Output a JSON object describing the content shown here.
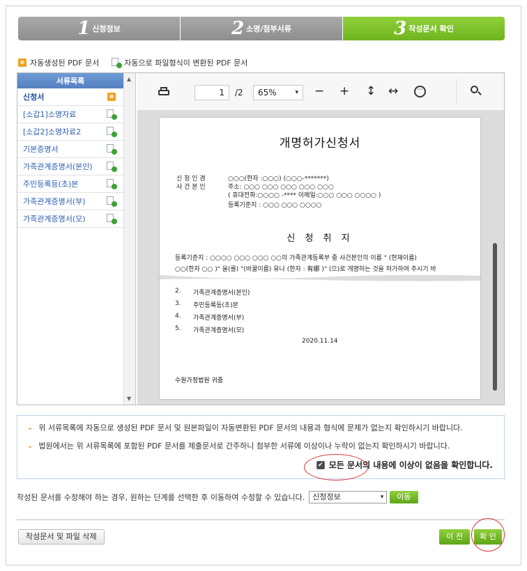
{
  "steps": [
    {
      "num": "1",
      "label": "신청정보"
    },
    {
      "num": "2",
      "label": "소명/첨부서류"
    },
    {
      "num": "3",
      "label": "작성문서 확인"
    }
  ],
  "legend": {
    "auto_pdf": "자동생성된 PDF 문서",
    "converted_pdf": "자동으로 파일형식이 변환된 PDF 문서"
  },
  "doc_list": {
    "header": "서류목록",
    "items": [
      {
        "label": "신청서",
        "icon": "e-icon"
      },
      {
        "label": "[소갑1]소명자료",
        "icon": "converted-doc-icon"
      },
      {
        "label": "[소갑2]소명자료2",
        "icon": "converted-doc-icon"
      },
      {
        "label": "기본증명서",
        "icon": "converted-doc-icon"
      },
      {
        "label": "가족관계증명서(본인)",
        "icon": "converted-doc-icon"
      },
      {
        "label": "주민등록등(초)본",
        "icon": "converted-doc-icon"
      },
      {
        "label": "가족관계증명서(부)",
        "icon": "converted-doc-icon"
      },
      {
        "label": "가족관계증명서(모)",
        "icon": "converted-doc-icon"
      }
    ]
  },
  "pdf_toolbar": {
    "page_current": "1",
    "page_total": "/2",
    "zoom": "65%",
    "zoom_out": "−",
    "zoom_in": "+",
    "fit_height": "↕",
    "fit_width": "↔",
    "more": "···"
  },
  "pdf_page": {
    "title": "개명허가신청서",
    "applicant_label1": "신 청 인 겸",
    "applicant_label2": "사 건 본 인",
    "applicant_name": "○○○(한자 :○○○) (○○○-*******)",
    "address": "주소: ○○○ ○○○ ○○○ ○○○ ○○○",
    "contact": "( 휴대전화:○○○○ -****   이메일:○○○ ○○○ ○○○○ )",
    "registry": "등록기준지 : ○○○ ○○○ ○○○○",
    "section_title": "신 청 취 지",
    "purpose_line1": "등록기준지 : ○○○○ ○○○ ○○○ ○○의 가족관계등록부 중 사건본인의 이름 \" (현재이름)",
    "purpose_line2": "○○(한자 ○○ )\" 을(를) \"(바꿀이름) 유나 (한자 : 有娜 )\" (으)로 개명하는 것을 허가하여 주시기 바",
    "attachments": [
      {
        "no": "2.",
        "label": "가족관계증명서(본인)"
      },
      {
        "no": "3.",
        "label": "주민등록등(초)본"
      },
      {
        "no": "4.",
        "label": "가족관계증명서(부)"
      },
      {
        "no": "5.",
        "label": "가족관계증명서(모)"
      }
    ],
    "date": "2020.11.14",
    "court": "수원가정법원 귀중"
  },
  "confirm": {
    "line1": "위 서류목록에 자동으로 생성된 PDF 문서 및 원본파일이 자동변환된 PDF 문서의 내용과 형식에 문제가 없는지 확인하시기 바랍니다.",
    "line2": "법원에서는 위 서류목록에 포함된 PDF 문서를 제출문서로 간주하니 첨부한 서류에 이상이나 누락이 없는지 확인하시기 바랍니다.",
    "agree_label": "모든 문서의 내용에 이상이 없음을 확인합니다."
  },
  "modify": {
    "text": "작성된 문서를 수정해야 하는 경우, 원하는 단계를 선택한 후 이동하여 수정할 수 있습니다.",
    "selected_step": "신청정보",
    "move_button": "이동"
  },
  "footer": {
    "delete_button": "작성문서 및 파일 삭제",
    "prev_button": "이 전",
    "ok_button": "확 인"
  },
  "colors": {
    "accent_green": "#7cc22a",
    "step_gray": "#9a9a9a",
    "link_blue": "#2a5db0",
    "annotation_red": "#e03030"
  }
}
